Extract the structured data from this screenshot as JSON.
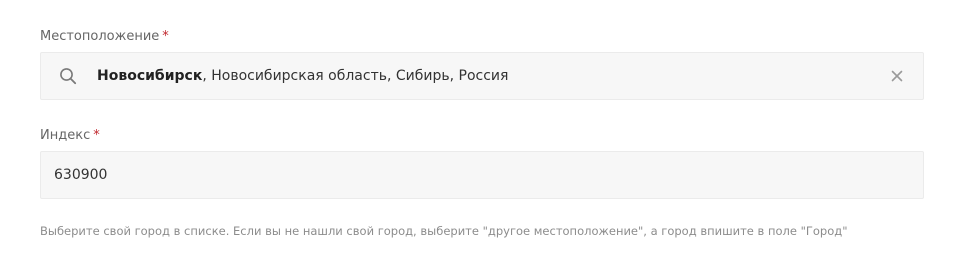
{
  "location": {
    "label": "Местоположение",
    "required_mark": "*",
    "city": "Новосибирск",
    "rest": ", Новосибирская область, Сибирь, Россия"
  },
  "index": {
    "label": "Индекс",
    "required_mark": "*",
    "value": "630900"
  },
  "hint": "Выберите свой город в списке. Если вы не нашли свой город, выберите \"другое местоположение\", а город впишите в поле \"Город\"",
  "colors": {
    "required": "#c0262c",
    "field_bg": "#f7f7f7",
    "label": "#666666",
    "hint": "#8c8c8c"
  },
  "icons": {
    "search": "search-icon",
    "clear": "close-icon"
  }
}
